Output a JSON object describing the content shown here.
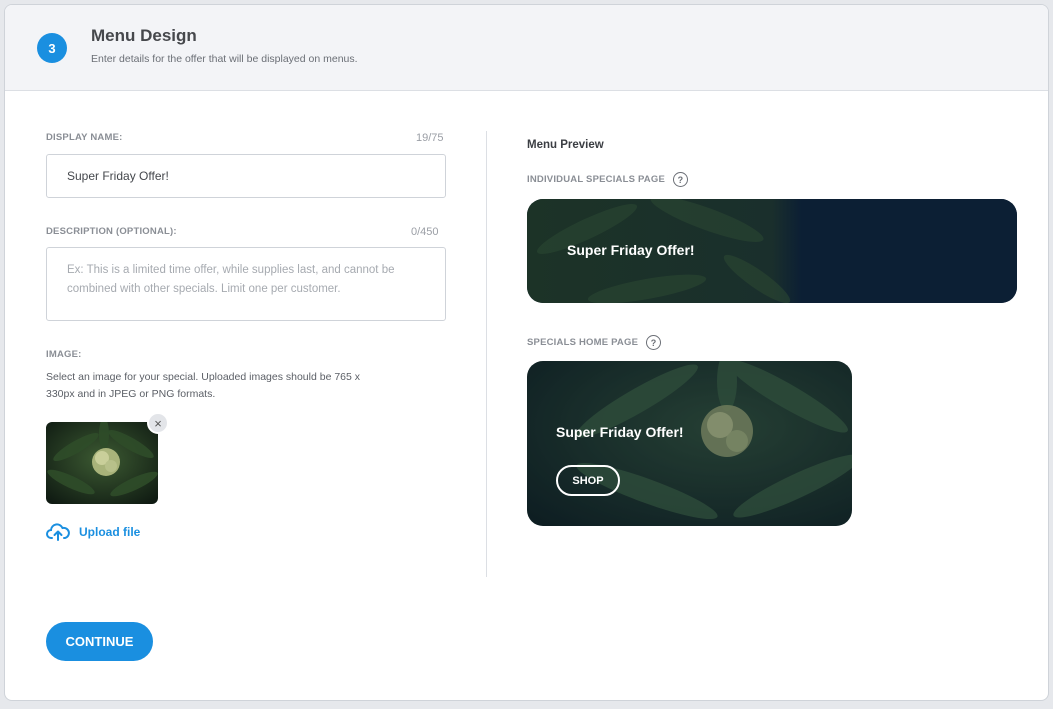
{
  "header": {
    "step": "3",
    "title": "Menu Design",
    "subtitle": "Enter details for the offer that will be displayed on menus."
  },
  "form": {
    "display_name_label": "DISPLAY NAME:",
    "display_name_count": "19/75",
    "display_name_value": "Super Friday Offer!",
    "description_label": "DESCRIPTION (OPTIONAL):",
    "description_count": "0/450",
    "description_placeholder": "Ex: This is a limited time offer, while supplies last, and cannot be combined with other specials. Limit one per customer.",
    "image_label": "IMAGE:",
    "image_help": "Select an image for your special. Uploaded images should be 765 x 330px and in JPEG or PNG formats.",
    "remove_symbol": "×",
    "upload_label": "Upload file"
  },
  "preview": {
    "title": "Menu Preview",
    "individual_label": "INDIVIDUAL SPECIALS PAGE",
    "home_label": "SPECIALS HOME PAGE",
    "help_symbol": "?",
    "offer_text": "Super Friday Offer!",
    "shop_label": "SHOP"
  },
  "footer": {
    "continue_label": "CONTINUE"
  },
  "colors": {
    "accent": "#1a8fe0",
    "banner_dark": "#0c1f34"
  },
  "icons": {
    "upload": "cloud-upload-icon",
    "help": "question-circle-icon",
    "remove": "close-icon"
  }
}
